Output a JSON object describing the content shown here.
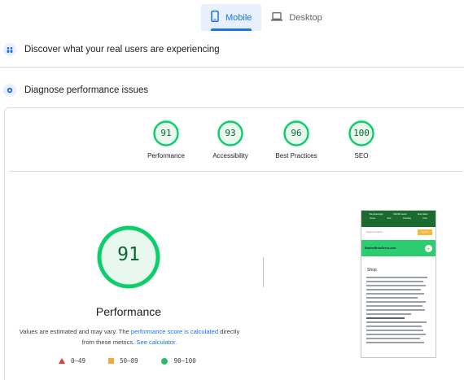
{
  "tabs": [
    {
      "label": "Mobile",
      "icon": "phone-icon",
      "active": true
    },
    {
      "label": "Desktop",
      "icon": "laptop-icon",
      "active": false
    }
  ],
  "sections": {
    "field": {
      "label": "Discover what your real users are experiencing",
      "icon": "people-icon"
    },
    "lab": {
      "label": "Diagnose performance issues",
      "icon": "flask-icon"
    }
  },
  "scores": [
    {
      "label": "Performance",
      "value": "91"
    },
    {
      "label": "Accessibility",
      "value": "93"
    },
    {
      "label": "Best Practices",
      "value": "96"
    },
    {
      "label": "SEO",
      "value": "100"
    }
  ],
  "main": {
    "score": "91",
    "label": "Performance",
    "note_pre": "Values are estimated and may vary. The ",
    "note_link1": "performance score is calculated",
    "note_mid": " directly from these metrics. ",
    "note_link2": "See calculator."
  },
  "legend": [
    {
      "shape": "triangle",
      "range": "0–49",
      "color": "#e53935"
    },
    {
      "shape": "square",
      "range": "50–89",
      "color": "#f6a73a"
    },
    {
      "shape": "circle",
      "range": "90–100",
      "color": "#2bbd63"
    }
  ],
  "thumbnail": {
    "nav_row1": [
      "Shop Evenings",
      "PAKISH Jeans",
      "Shop Skirts"
    ],
    "nav_row2": [
      "Dress",
      "Size",
      "Trending",
      "Cute"
    ],
    "search_placeholder": "Search products...",
    "search_button": "Search",
    "brand": "MotherBrideDress.com",
    "heading": "Shop"
  },
  "colors": {
    "accent": "#1a73e8",
    "pass": "#0cce6b",
    "pass_fill": "#e8f8ee",
    "pass_text": "#0d652d"
  }
}
